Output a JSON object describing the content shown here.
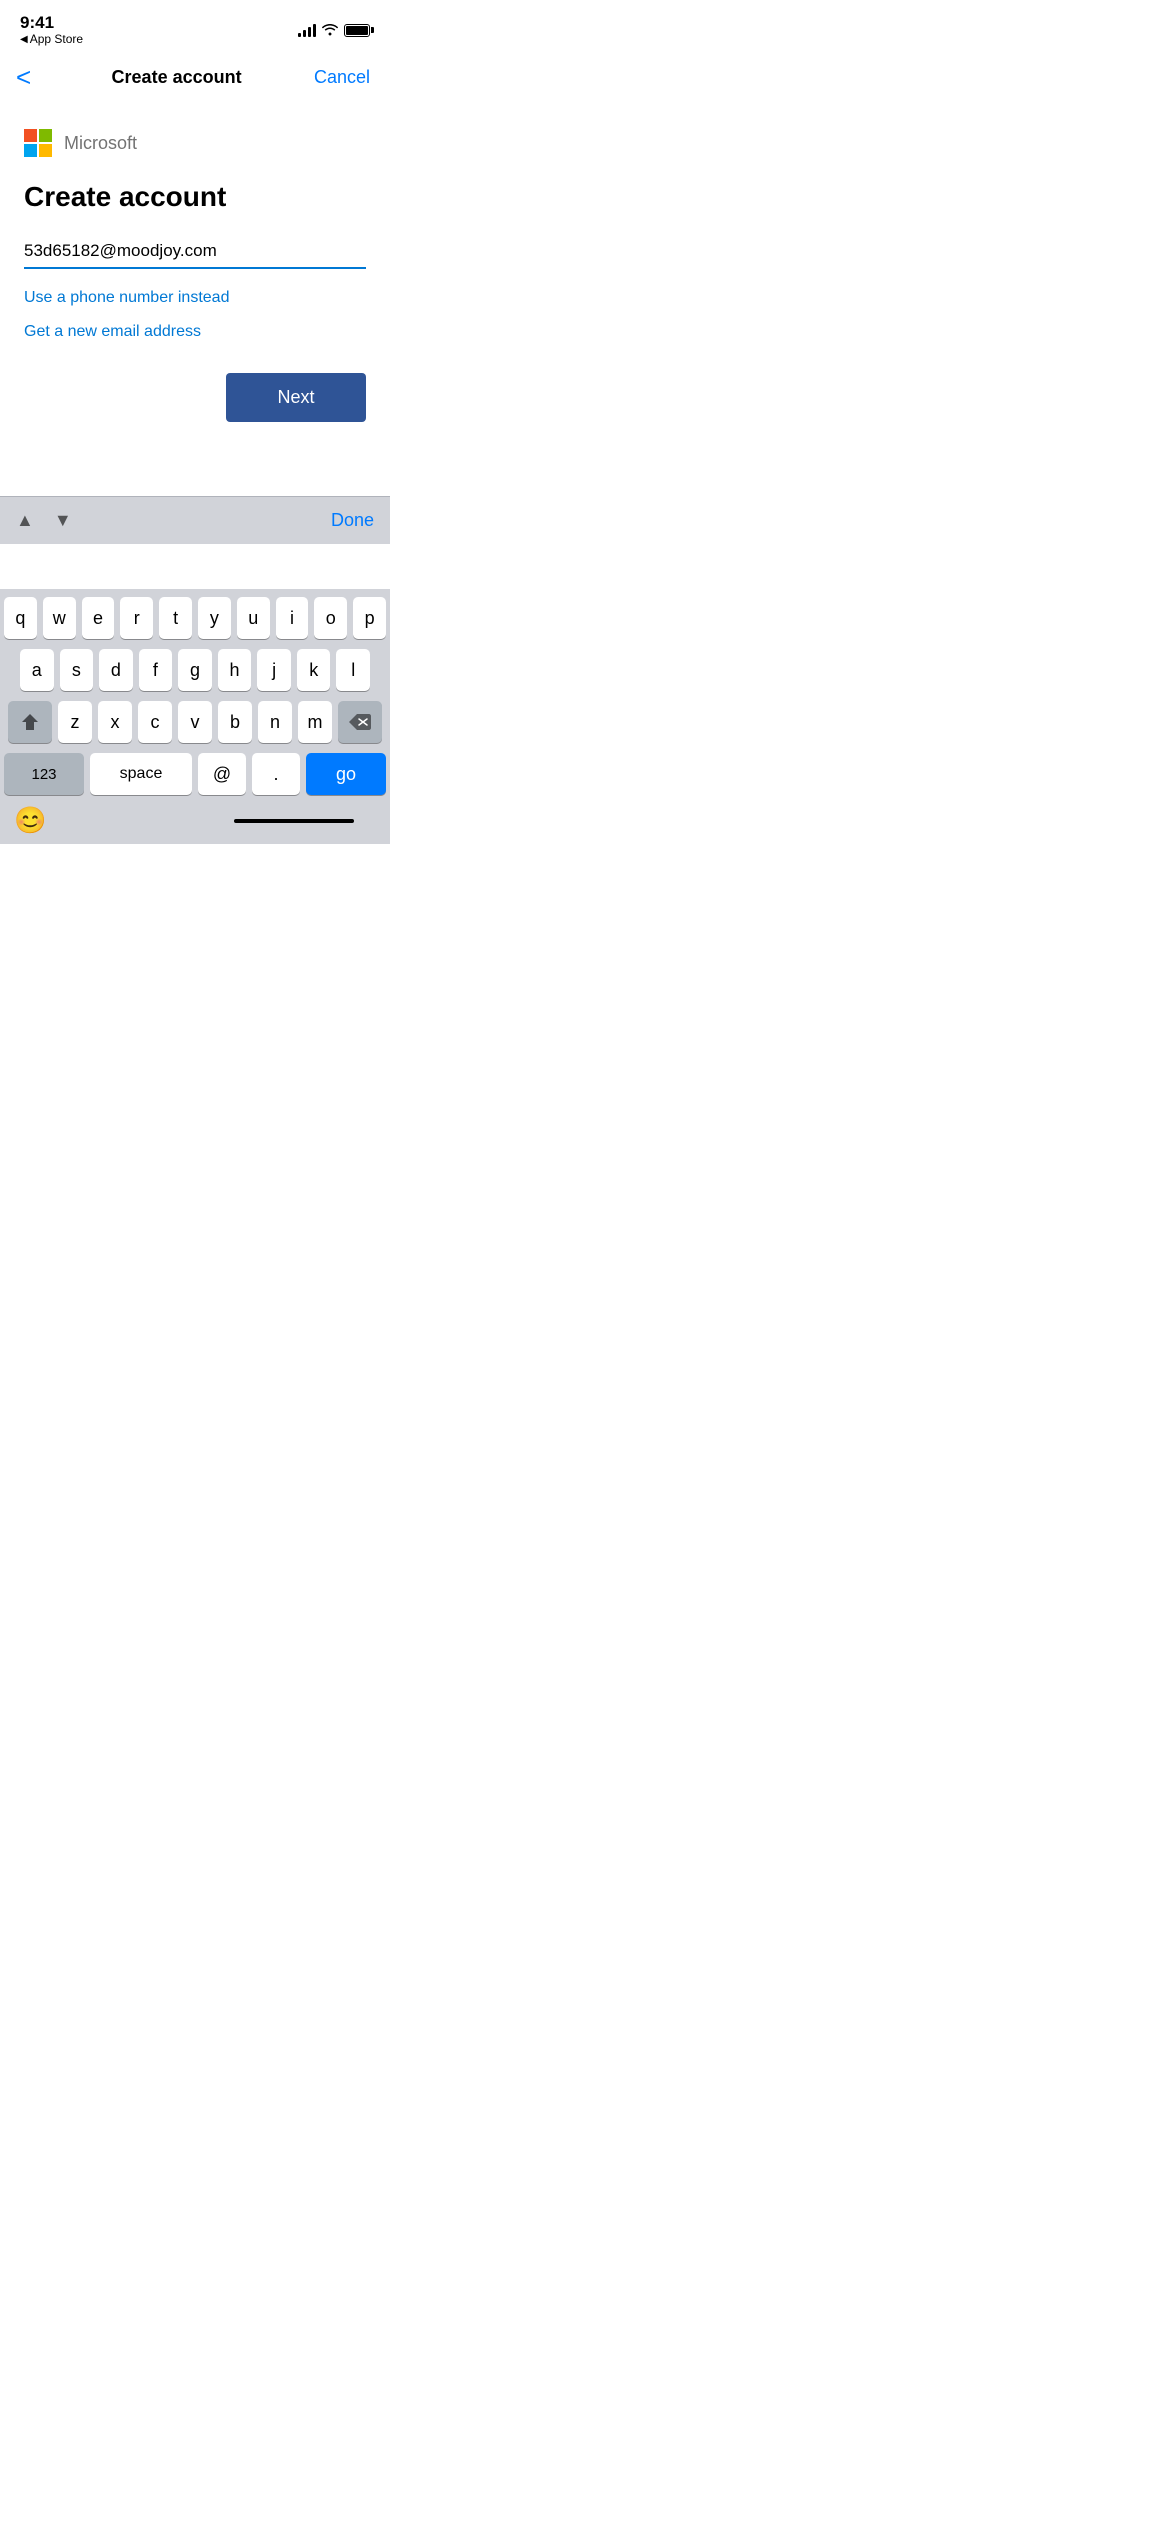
{
  "statusBar": {
    "time": "9:41",
    "appStore": "App Store",
    "backArrow": "◀"
  },
  "navBar": {
    "backArrow": "<",
    "title": "Create account",
    "cancelLabel": "Cancel"
  },
  "microsoft": {
    "logoLabel": "Microsoft"
  },
  "form": {
    "title": "Create account",
    "emailValue": "53d65182@moodjoy.com",
    "phoneLink": "Use a phone number instead",
    "emailLink": "Get a new email address",
    "nextButton": "Next"
  },
  "keyboardToolbar": {
    "upArrow": "▲",
    "downArrow": "▼",
    "doneLabel": "Done"
  },
  "keyboard": {
    "row1": [
      "q",
      "w",
      "e",
      "r",
      "t",
      "y",
      "u",
      "i",
      "o",
      "p"
    ],
    "row2": [
      "a",
      "s",
      "d",
      "f",
      "g",
      "h",
      "j",
      "k",
      "l"
    ],
    "row3": [
      "z",
      "x",
      "c",
      "v",
      "b",
      "n",
      "m"
    ],
    "row4": {
      "num": "123",
      "space": "space",
      "at": "@",
      "dot": ".",
      "go": "go"
    },
    "emoji": "😊"
  }
}
